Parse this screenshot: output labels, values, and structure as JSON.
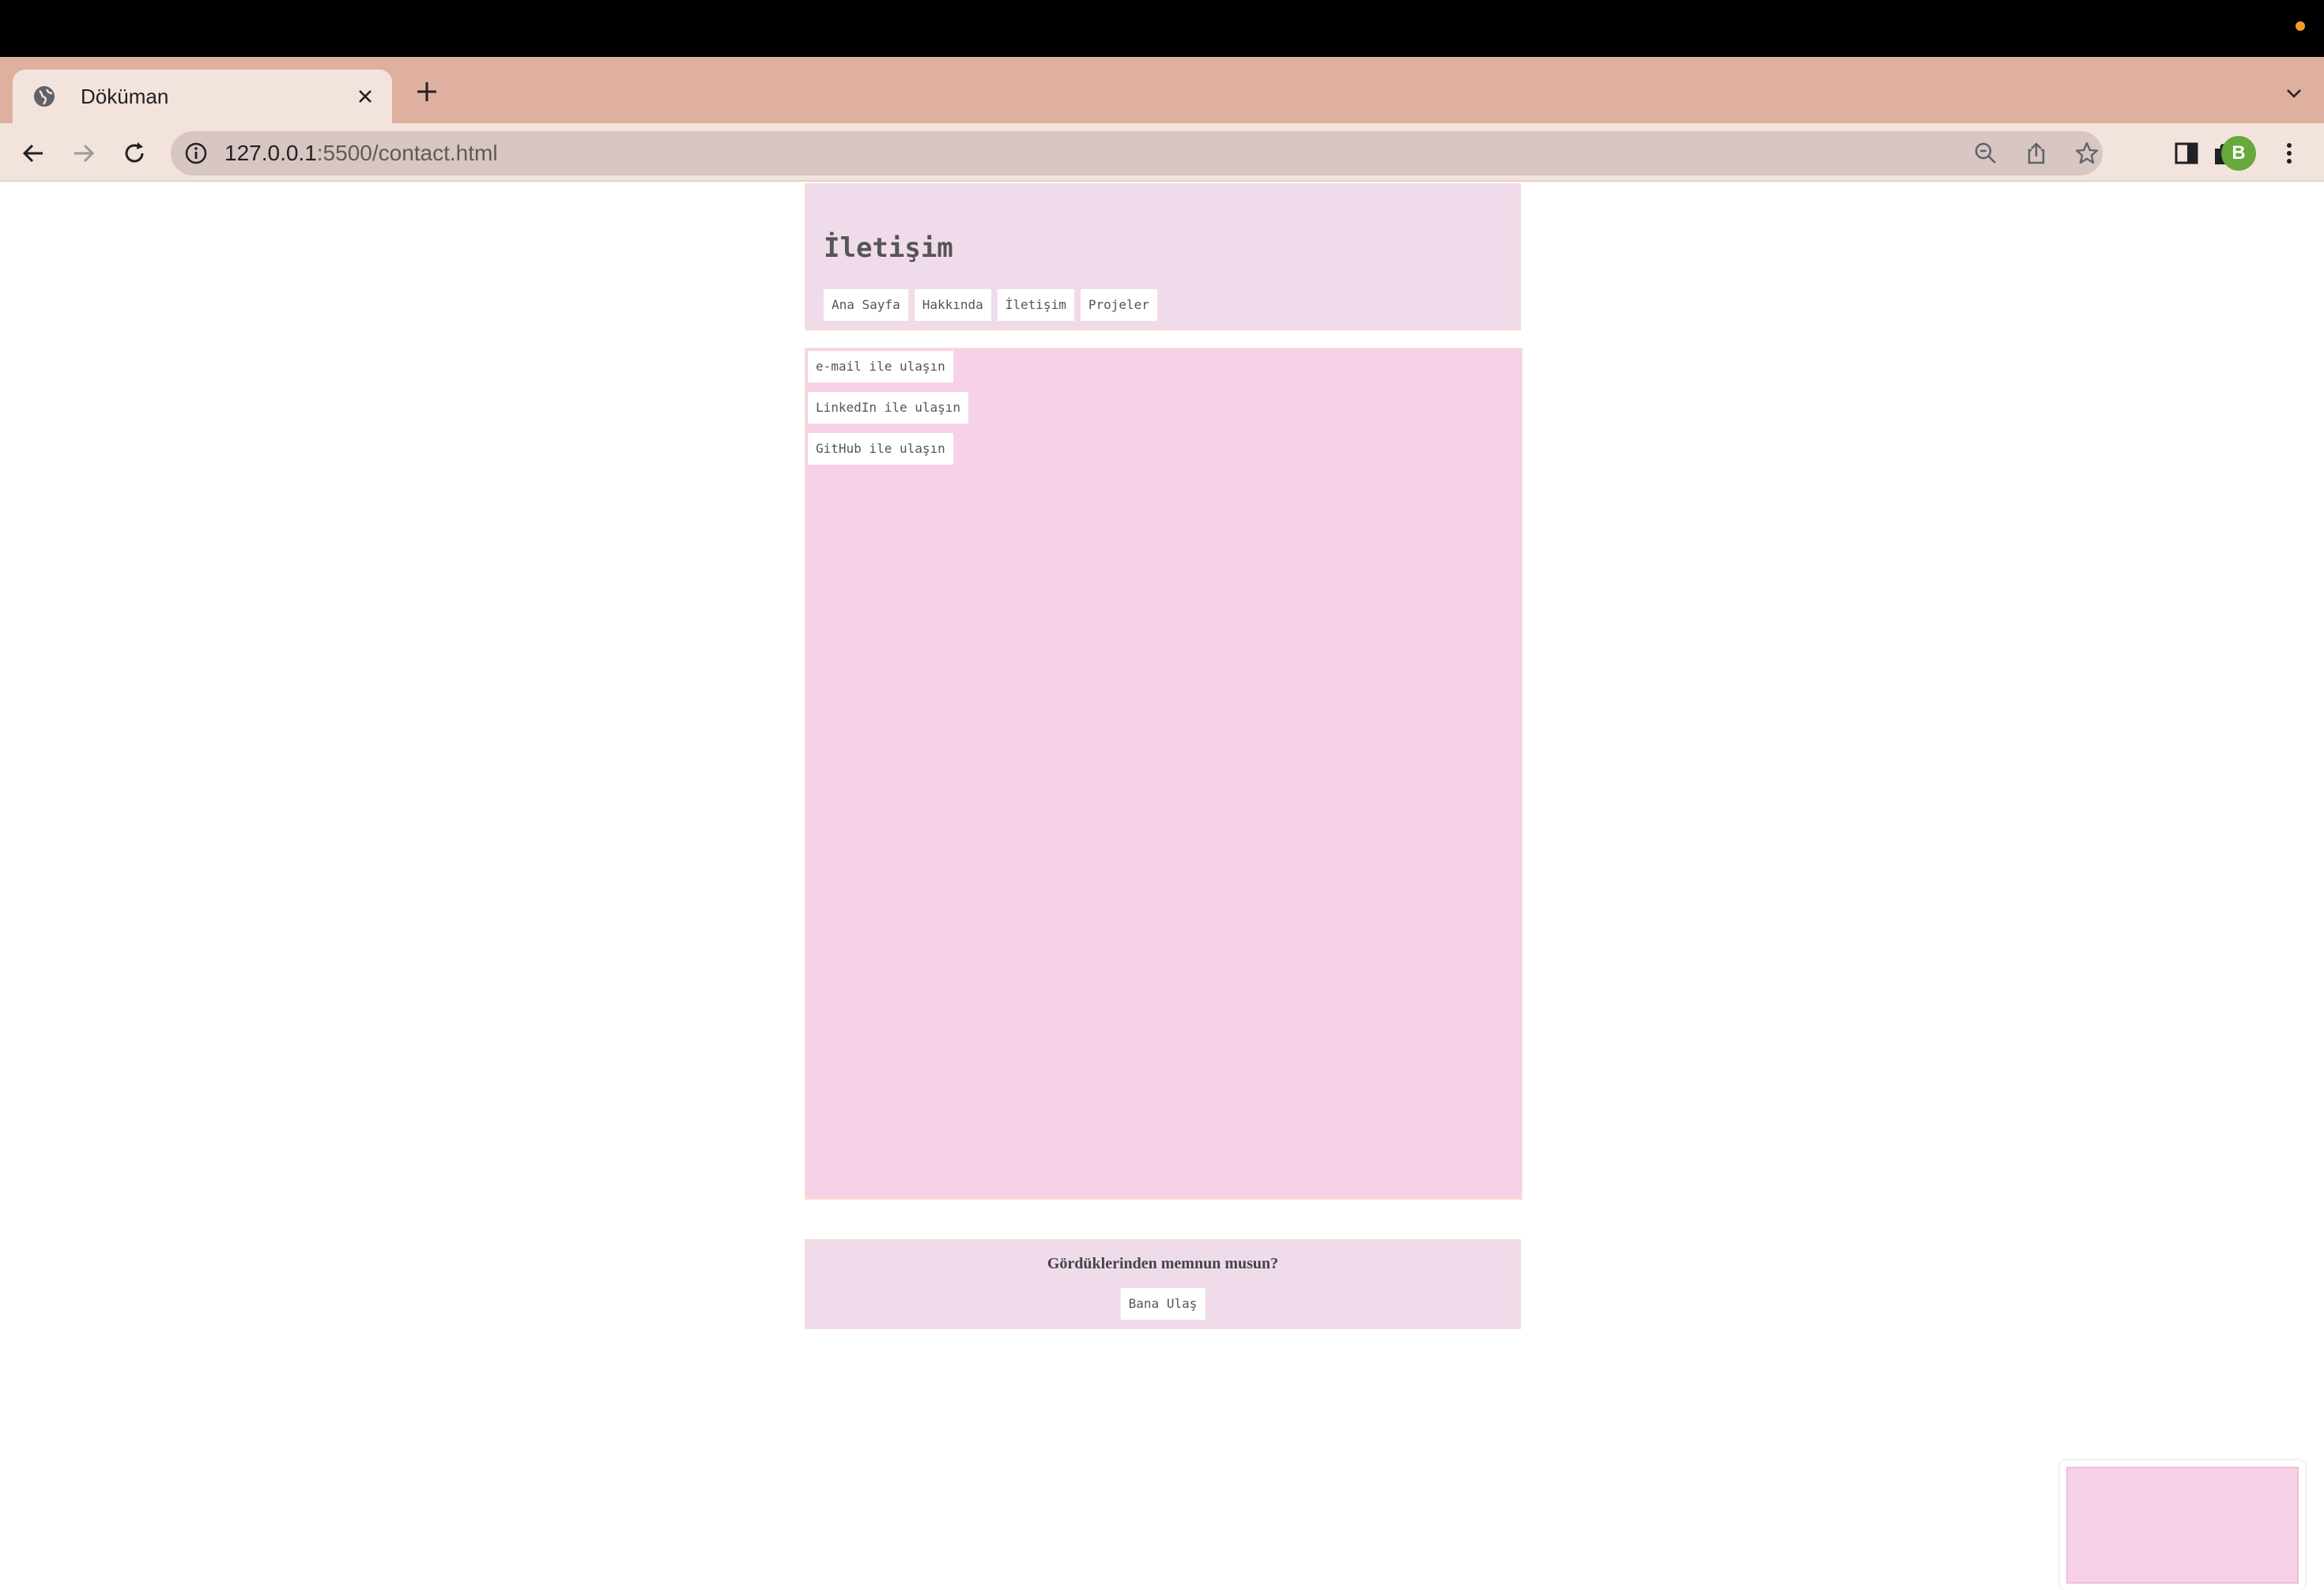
{
  "colors": {
    "system_dot": "#f29b2f",
    "avatar_bg": "#67a93b",
    "tabstrip_bg": "#dfaf9f",
    "toolbar_bg": "#f3e3dd",
    "header_bg": "#f0dbeb",
    "content_bg": "#f7d1e8"
  },
  "browser": {
    "tab": {
      "title": "Döküman",
      "favicon": "globe-icon",
      "close_icon": "close-icon"
    },
    "new_tab_icon": "plus-icon",
    "tab_search_icon": "chevron-down-icon",
    "toolbar": {
      "back_icon": "arrow-left-icon",
      "forward_icon": "arrow-right-icon",
      "reload_icon": "reload-icon",
      "site_info_icon": "info-icon",
      "url_host": "127.0.0.1",
      "url_rest": ":5500/contact.html",
      "zoom_icon": "zoom-out-icon",
      "share_icon": "share-icon",
      "bookmark_icon": "star-icon",
      "extensions_icon": "puzzle-icon",
      "side_panel_icon": "side-panel-icon",
      "profile_initial": "B",
      "menu_icon": "kebab-menu-icon"
    }
  },
  "page": {
    "title": "İletişim",
    "nav": [
      "Ana Sayfa",
      "Hakkında",
      "İletişim",
      "Projeler"
    ],
    "contact_links": [
      "e-mail ile ulaşın",
      "LinkedIn ile ulaşın",
      "GitHub ile ulaşın"
    ],
    "footer": {
      "question": "Gördüklerinden memnun musun?",
      "button": "Bana Ulaş"
    }
  }
}
